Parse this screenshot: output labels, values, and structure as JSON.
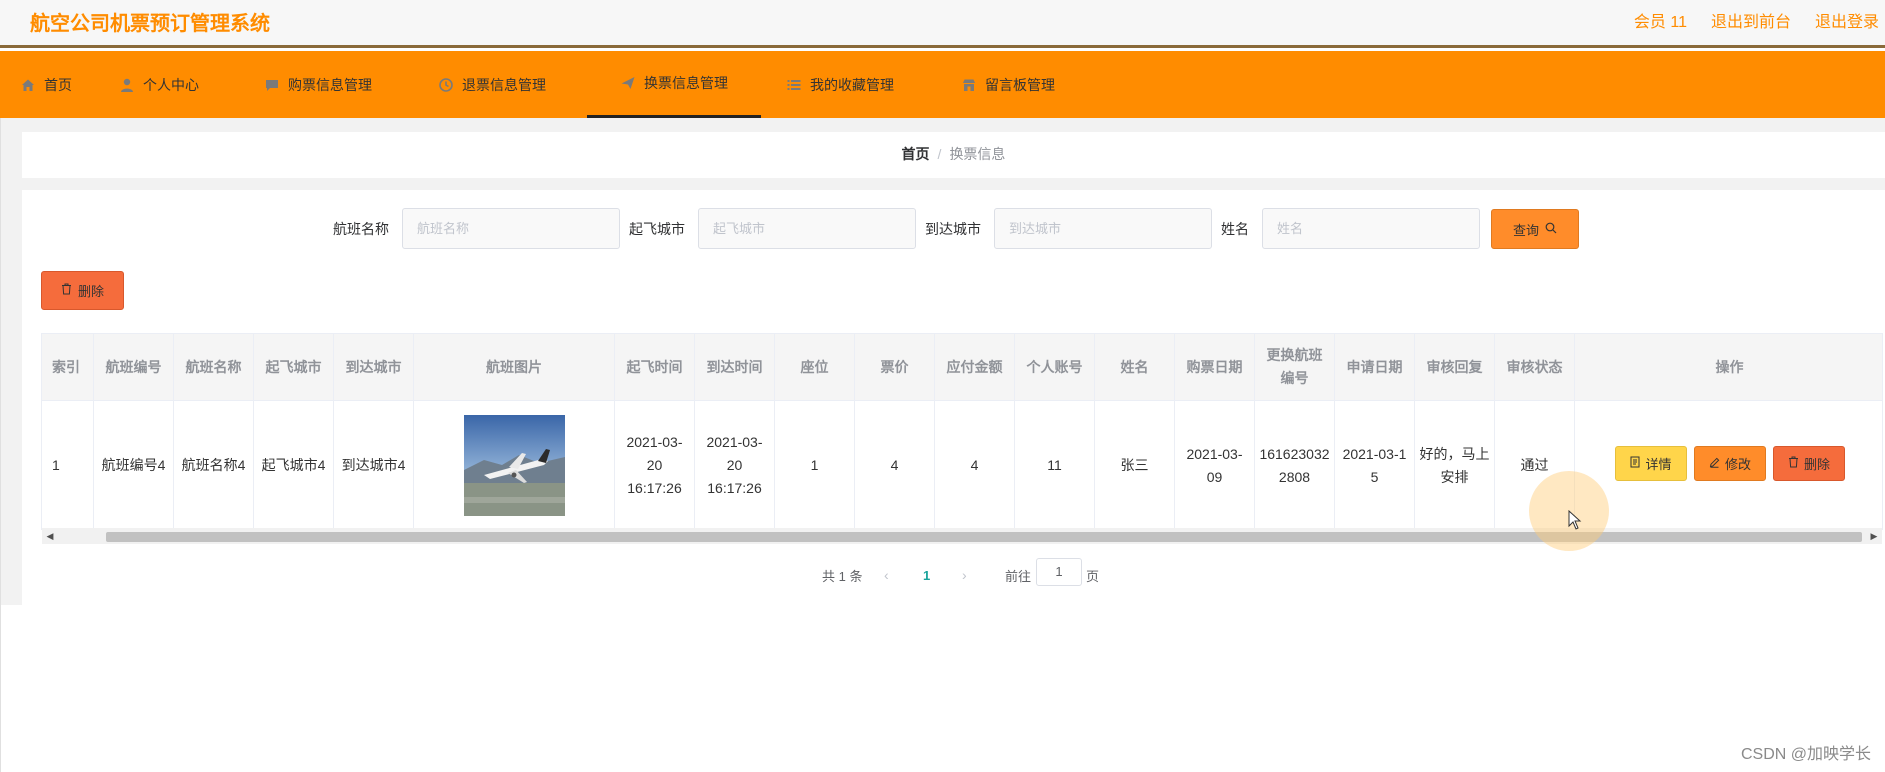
{
  "header": {
    "title": "航空公司机票预订管理系统",
    "links": [
      "会员 11",
      "退出到前台",
      "退出登录"
    ]
  },
  "nav": {
    "items": [
      {
        "label": "首页",
        "icon": "home-icon"
      },
      {
        "label": "个人中心",
        "icon": "user-icon"
      },
      {
        "label": "购票信息管理",
        "icon": "chat-icon"
      },
      {
        "label": "退票信息管理",
        "icon": "clock-icon"
      },
      {
        "label": "换票信息管理",
        "icon": "plane-icon"
      },
      {
        "label": "我的收藏管理",
        "icon": "list-icon"
      },
      {
        "label": "留言板管理",
        "icon": "shop-icon"
      }
    ],
    "active_index": 4
  },
  "breadcrumb": {
    "home": "首页",
    "separator": "/",
    "current": "换票信息"
  },
  "search": {
    "fields": [
      {
        "label": "航班名称",
        "placeholder": "航班名称"
      },
      {
        "label": "起飞城市",
        "placeholder": "起飞城市"
      },
      {
        "label": "到达城市",
        "placeholder": "到达城市"
      },
      {
        "label": "姓名",
        "placeholder": "姓名"
      }
    ],
    "query_button": "查询"
  },
  "toolbar": {
    "delete_label": "删除"
  },
  "table": {
    "headers": [
      "索引",
      "航班编号",
      "航班名称",
      "起飞城市",
      "到达城市",
      "航班图片",
      "起飞时间",
      "到达时间",
      "座位",
      "票价",
      "应付金额",
      "个人账号",
      "姓名",
      "购票日期",
      "更换航班编号",
      "申请日期",
      "审核回复",
      "审核状态",
      "操作"
    ],
    "rows": [
      {
        "index": "1",
        "flight_no": "航班编号4",
        "flight_name": "航班名称4",
        "from_city": "起飞城市4",
        "to_city": "到达城市4",
        "depart_time": "2021-03-20 16:17:26",
        "arrive_time": "2021-03-20 16:17:26",
        "seat": "1",
        "price": "4",
        "amount_due": "4",
        "account": "11",
        "name": "张三",
        "purchase_date": "2021-03-09",
        "new_flight_no": "1616230322808",
        "apply_date": "2021-03-15",
        "review_reply": "好的，马上安排",
        "review_status": "通过"
      }
    ],
    "actions": {
      "detail": "详情",
      "edit": "修改",
      "delete": "删除"
    }
  },
  "pagination": {
    "total": "共 1 条",
    "current": "1",
    "goto_prefix": "前往",
    "goto_value": "1",
    "goto_suffix": "页"
  },
  "watermark": "CSDN @加映学长",
  "colors": {
    "accent": "#ff8c00",
    "query": "#ff8c2a",
    "danger": "#f56c3c",
    "detail": "#ffd54a",
    "page_active": "#1aa39b"
  }
}
